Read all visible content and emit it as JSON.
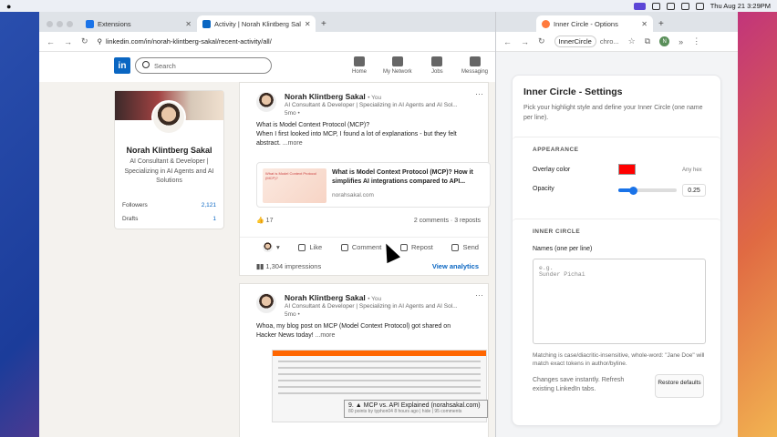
{
  "menubar": {
    "datetime": "Thu Aug 21  3:29PM"
  },
  "main_window": {
    "tabs": [
      {
        "label": "Extensions"
      },
      {
        "label": "Activity | Norah Klintberg Sal"
      }
    ],
    "url": "linkedin.com/in/norah-klintberg-sakal/recent-activity/all/"
  },
  "linkedin": {
    "logo": "in",
    "search_placeholder": "Search",
    "nav": [
      {
        "label": "Home"
      },
      {
        "label": "My Network"
      },
      {
        "label": "Jobs"
      },
      {
        "label": "Messaging"
      }
    ],
    "profile": {
      "name": "Norah Klintberg Sakal",
      "headline": "AI Consultant & Developer | Specializing in AI Agents and AI Solutions",
      "stats": [
        {
          "label": "Followers",
          "value": "2,121"
        },
        {
          "label": "Drafts",
          "value": "1"
        }
      ]
    },
    "posts": [
      {
        "author": "Norah Klintberg Sakal",
        "badge": "• You",
        "subtitle": "AI Consultant & Developer | Specializing in AI Agents and AI Sol...",
        "time": "5mo •",
        "text_line1": "What is Model Context Protocol (MCP)?",
        "text_line2": "When I first looked into MCP, I found a lot of explanations - but they felt",
        "text_line3": "abstract.",
        "more": "...more",
        "link_title": "What is Model Context Protocol (MCP)? How it simplifies AI integrations compared to API...",
        "link_domain": "norahsakal.com",
        "thumb_text": "What is Model Context Protocol (MCP)?",
        "reactions": "17",
        "stats": "2 comments · 3 reposts",
        "actions": [
          "Like",
          "Comment",
          "Repost",
          "Send"
        ],
        "impressions": "1,304 impressions",
        "analytics": "View analytics"
      },
      {
        "author": "Norah Klintberg Sakal",
        "badge": "• You",
        "subtitle": "AI Consultant & Developer | Specializing in AI Agents and AI Sol...",
        "time": "5mo •",
        "text_line1": "Whoa, my blog post on MCP (Model Context Protocol) got shared on",
        "text_line2": "Hacker News today!",
        "more": "...more",
        "hn_title": "9. ▲ MCP vs. API Explained (norahsakal.com)",
        "hn_meta": "80 points by typhon04 8 hours ago | hide | 95 comments"
      }
    ]
  },
  "options_window": {
    "tabs": [
      {
        "label": "Inner Circle - Options"
      }
    ],
    "url_chip": "InnerCircle",
    "url_rest": "chro...",
    "avatar_letter": "N",
    "title": "Inner Circle - Settings",
    "description": "Pick your highlight style and define your Inner Circle (one name per line).",
    "appearance": {
      "header": "APPEARANCE",
      "overlay_label": "Overlay color",
      "overlay_color": "#ff0000",
      "any_hex": "Any hex",
      "opacity_label": "Opacity",
      "opacity_value": "0.25"
    },
    "inner_circle": {
      "header": "INNER CIRCLE",
      "names_label": "Names (one per line)",
      "placeholder": "e.g.\nSunder Pichai",
      "matching_note": "Matching is case/diacritic-insensitive, whole-word: \"Jane Doe\" will match exact tokens in author/byline."
    },
    "save_note": "Changes save instantly. Refresh existing LinkedIn tabs.",
    "restore_label": "Restore defaults"
  }
}
